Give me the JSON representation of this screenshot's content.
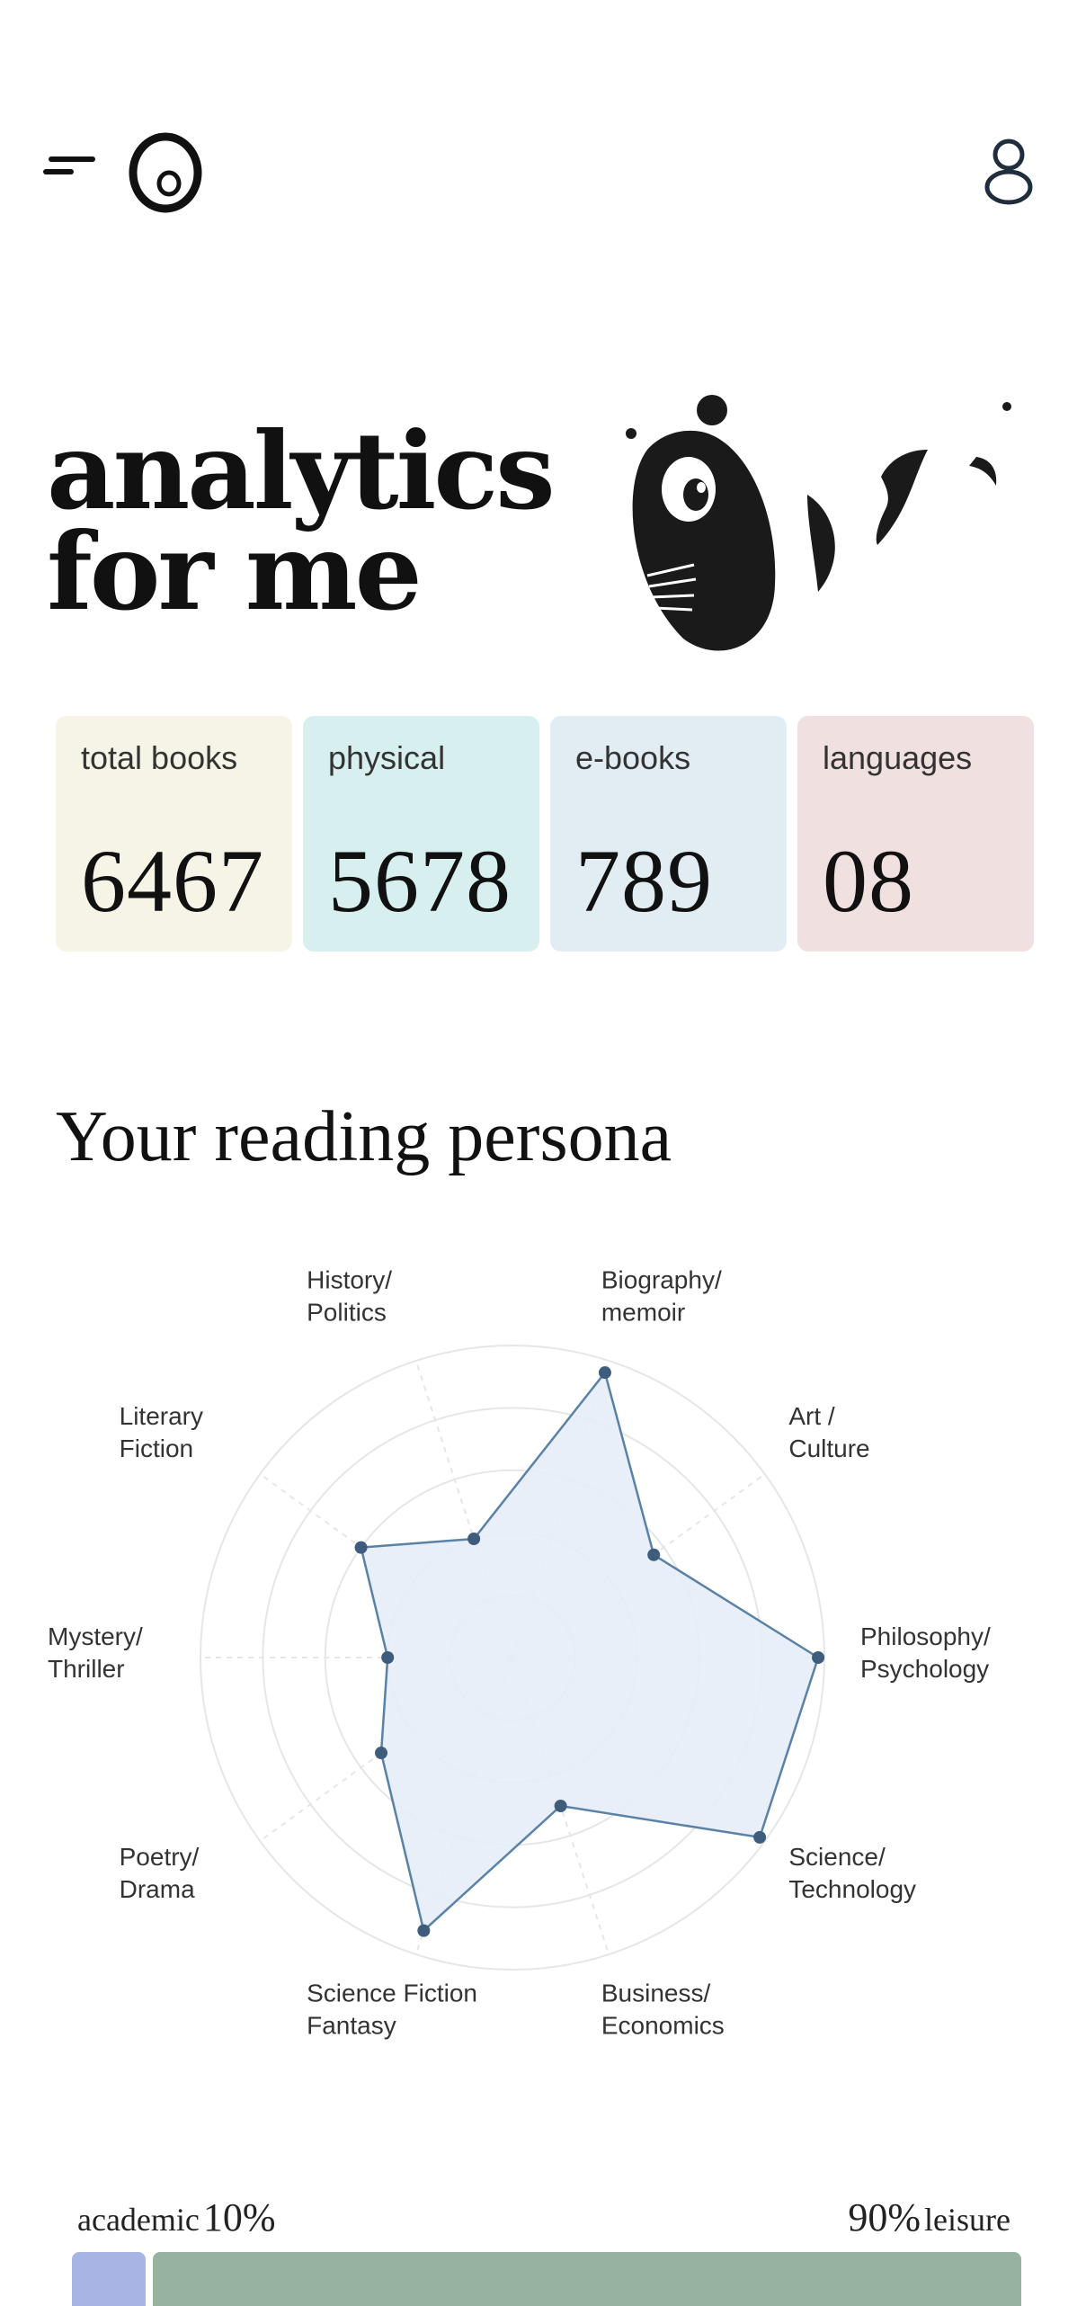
{
  "header": {
    "menu_icon": "menu-icon",
    "logo_icon": "logo-icon",
    "user_icon": "user-icon"
  },
  "hero": {
    "title_line1": "analytics",
    "title_line2": "for me",
    "mascot_icon": "mole-mascot-icon"
  },
  "stats": [
    {
      "label": "total books",
      "value": "6467",
      "color": "#f6f4e6"
    },
    {
      "label": "physical",
      "value": "5678",
      "color": "#d7f0ef"
    },
    {
      "label": "e-books",
      "value": "789",
      "color": "#e1ecf3"
    },
    {
      "label": "languages",
      "value": "08",
      "color": "#f0e0e0"
    }
  ],
  "persona": {
    "title": "Your reading persona",
    "chart_data": {
      "type": "radar",
      "max": 5,
      "rings": 5,
      "categories": [
        [
          "Biography/",
          "memoir"
        ],
        [
          "Art /",
          "Culture"
        ],
        [
          "Philosophy/",
          "Psychology"
        ],
        [
          "Science/",
          "Technology"
        ],
        [
          "Business/",
          "Economics"
        ],
        [
          "Science Fiction",
          "Fantasy"
        ],
        [
          "Poetry/",
          "Drama"
        ],
        [
          "Mystery/",
          "Thriller"
        ],
        [
          "Literary",
          "Fiction"
        ],
        [
          "History/",
          "Politics"
        ]
      ],
      "values": [
        4.8,
        2.8,
        4.9,
        4.9,
        2.5,
        4.6,
        2.6,
        2.0,
        3.0,
        2.0
      ],
      "fill_color": "#e5edf8",
      "line_color": "#5a82a6",
      "point_color": "#3e5d7d",
      "grid_color": "#e6e6e6"
    }
  },
  "balance": {
    "left_label": "academic",
    "left_pct": "10%",
    "right_pct": "90%",
    "right_label": "leisure",
    "academic_fraction": 0.078,
    "academic_color": "#a8b4e4",
    "leisure_color": "#98b2a0"
  }
}
